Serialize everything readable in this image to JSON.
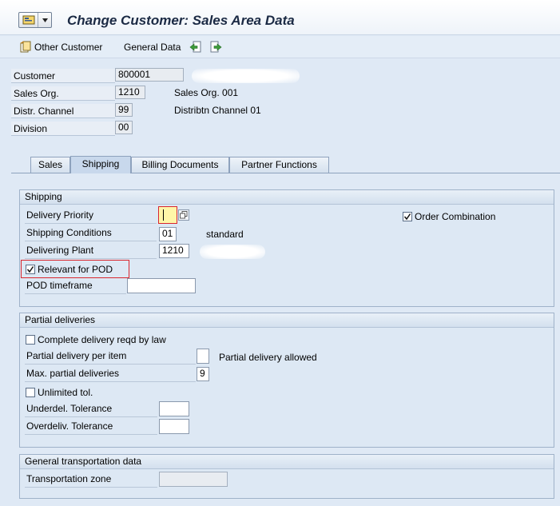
{
  "title": "Change Customer: Sales Area Data",
  "toolbar": {
    "other_customer": "Other Customer",
    "general_data": "General Data"
  },
  "header": {
    "customer_label": "Customer",
    "customer_value": "800001",
    "sales_org_label": "Sales Org.",
    "sales_org_value": "1210",
    "sales_org_desc": "Sales Org. 001",
    "distr_channel_label": "Distr. Channel",
    "distr_channel_value": "99",
    "distr_channel_desc": "Distribtn Channel 01",
    "division_label": "Division",
    "division_value": "00"
  },
  "tabs": [
    "Sales",
    "Shipping",
    "Billing Documents",
    "Partner Functions"
  ],
  "shipping": {
    "title": "Shipping",
    "delivery_priority_label": "Delivery Priority",
    "delivery_priority_value": "",
    "order_combination_label": "Order Combination",
    "order_combination_checked": true,
    "shipping_conditions_label": "Shipping Conditions",
    "shipping_conditions_value": "01",
    "shipping_conditions_desc": "standard",
    "delivering_plant_label": "Delivering Plant",
    "delivering_plant_value": "1210",
    "relevant_pod_label": "Relevant for POD",
    "relevant_pod_checked": true,
    "pod_timeframe_label": "POD timeframe",
    "pod_timeframe_value": ""
  },
  "partial": {
    "title": "Partial deliveries",
    "complete_delivery_label": "Complete delivery reqd by law",
    "partial_per_item_label": "Partial delivery per item",
    "partial_per_item_value": "",
    "partial_per_item_desc": "Partial delivery allowed",
    "max_partial_label": "Max. partial deliveries",
    "max_partial_value": "9",
    "unlimited_tol_label": "Unlimited tol.",
    "underdel_label": "Underdel. Tolerance",
    "underdel_value": "",
    "overdeliv_label": "Overdeliv. Tolerance",
    "overdeliv_value": ""
  },
  "transport": {
    "title": "General transportation data",
    "zone_label": "Transportation zone",
    "zone_value": ""
  },
  "colors": {
    "background": "#dfe9f5",
    "highlight": "#d9262e",
    "field_focus": "#fff6a8"
  }
}
